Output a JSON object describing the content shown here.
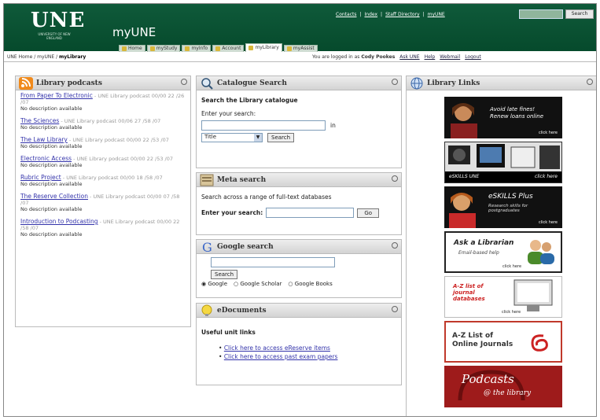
{
  "header": {
    "logo": "UNE",
    "logo_sub": "UNIVERSITY OF NEW ENGLAND",
    "app_title": "myUNE",
    "top_links": [
      "Contacts",
      "Index",
      "Staff Directory",
      "myUNE"
    ],
    "search_button": "Search",
    "tabs": [
      {
        "label": "Home",
        "active": false
      },
      {
        "label": "myStudy",
        "active": false
      },
      {
        "label": "myInfo",
        "active": false
      },
      {
        "label": "Account",
        "active": false
      },
      {
        "label": "myLibrary",
        "active": true
      },
      {
        "label": "myAssist",
        "active": false
      }
    ]
  },
  "crumb": {
    "path_prefix": "UNE Home / myUNE / ",
    "path_current": "myLibrary",
    "logged_in_text": "You are logged in as",
    "user": "Cody Pookes",
    "links": [
      "Ask UNE",
      "Help",
      "Webmail",
      "Logout"
    ]
  },
  "podcasts": {
    "title": "Library podcasts",
    "items": [
      {
        "title": "From Paper To Electronic",
        "meta": " - UNE Library podcast 00/00 22 /26 /07",
        "desc": "No description available"
      },
      {
        "title": "The Sciences",
        "meta": " - UNE Library podcast 00/06 27 /58 /07",
        "desc": "No description available"
      },
      {
        "title": "The Law Library",
        "meta": " - UNE Library podcast 00/00 22 /53 /07",
        "desc": "No description available"
      },
      {
        "title": "Electronic Access",
        "meta": " - UNE Library podcast 00/00 22 /53 /07",
        "desc": "No description available"
      },
      {
        "title": "Rubric Project",
        "meta": " - UNE Library podcast 00/00 18 /58 /07",
        "desc": "No description available"
      },
      {
        "title": "The Reserve Collection",
        "meta": " - UNE Library podcast 00/00 07 /58 /07",
        "desc": "No description available"
      },
      {
        "title": "Introduction to Podcasting",
        "meta": " - UNE Library podcast 00/00 22 /58 /07",
        "desc": "No description available"
      }
    ]
  },
  "catalogue": {
    "title": "Catalogue Search",
    "heading": "Search the Library catalogue",
    "enter_label": "Enter your search:",
    "in_label": "in",
    "select_value": "Title",
    "button": "Search"
  },
  "meta": {
    "title": "Meta search",
    "desc": "Search across a range of full-text databases",
    "enter_label": "Enter your search:",
    "button": "Go"
  },
  "google": {
    "title": "Google search",
    "button": "Search",
    "options": [
      "Google",
      "Google Scholar",
      "Google Books"
    ]
  },
  "edocs": {
    "title": "eDocuments",
    "heading": "Useful unit links",
    "links": [
      "Click here to access eReserve items",
      "Click here to access past exam papers"
    ]
  },
  "links": {
    "title": "Library Links",
    "tiles": [
      {
        "line1": "Avoid late fines!",
        "line2": "Renew loans online",
        "small": "click here"
      },
      {
        "line1": "eSKILLS UNE",
        "small": "click here"
      },
      {
        "line1": "eSKILLS Plus",
        "line2": "Research skills for",
        "line3": "postgraduates",
        "small": "click here"
      },
      {
        "line1": "Ask a Librarian",
        "line2": "Email-based help",
        "small": "click here"
      },
      {
        "line1": "A-Z list of",
        "line2": "journal",
        "line3": "databases",
        "small": "click here"
      },
      {
        "line1": "A-Z List of",
        "line2": "Online Journals"
      },
      {
        "line1": "Podcasts",
        "line2": "@ the library"
      }
    ]
  }
}
